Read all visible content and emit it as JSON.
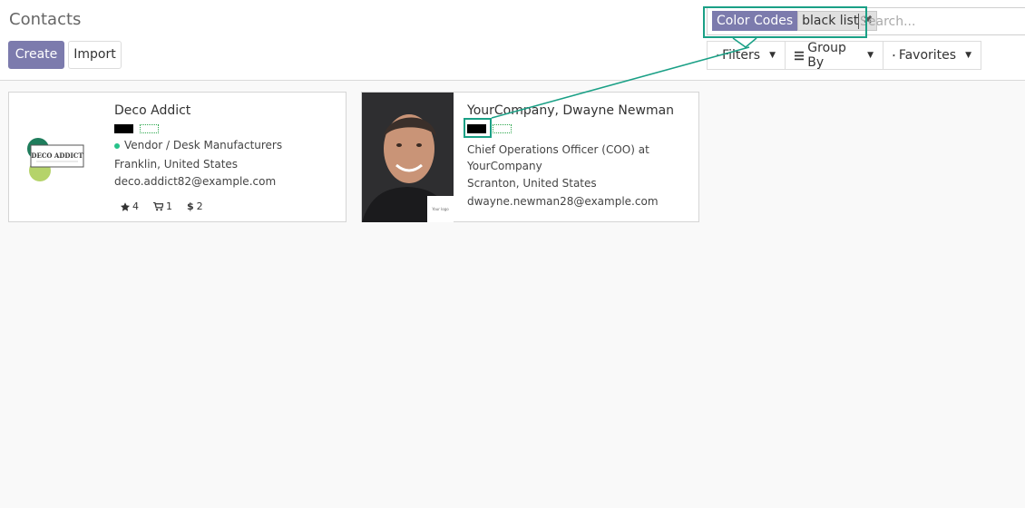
{
  "page": {
    "title": "Contacts"
  },
  "toolbar": {
    "create_label": "Create",
    "import_label": "Import"
  },
  "search": {
    "facet_category": "Color Codes",
    "facet_value": "black list",
    "remove_glyph": "✖",
    "placeholder": "Search..."
  },
  "dropdowns": {
    "filters": {
      "label": "Filters",
      "icon": "filter-icon"
    },
    "group_by": {
      "label": "Group By",
      "icon": "bars-icon"
    },
    "favorites": {
      "label": "Favorites",
      "icon": "star-icon"
    }
  },
  "cards": [
    {
      "name": "Deco Addict",
      "category": "Vendor / Desk Manufacturers",
      "location": "Franklin, United States",
      "email": "deco.addict82@example.com",
      "logo_text": "DECO ADDICT",
      "stats": {
        "stars": "4",
        "orders": "1",
        "invoices": "2"
      }
    },
    {
      "name": "YourCompany, Dwayne Newman",
      "job_line1": "Chief Operations Officer (COO) at",
      "job_line2": "YourCompany",
      "location": "Scranton, United States",
      "email": "dwayne.newman28@example.com",
      "chip_text": "Your logo"
    }
  ],
  "colors": {
    "accent": "#7c7bad",
    "highlight": "#1aa086",
    "status_dot": "#27c28a"
  }
}
